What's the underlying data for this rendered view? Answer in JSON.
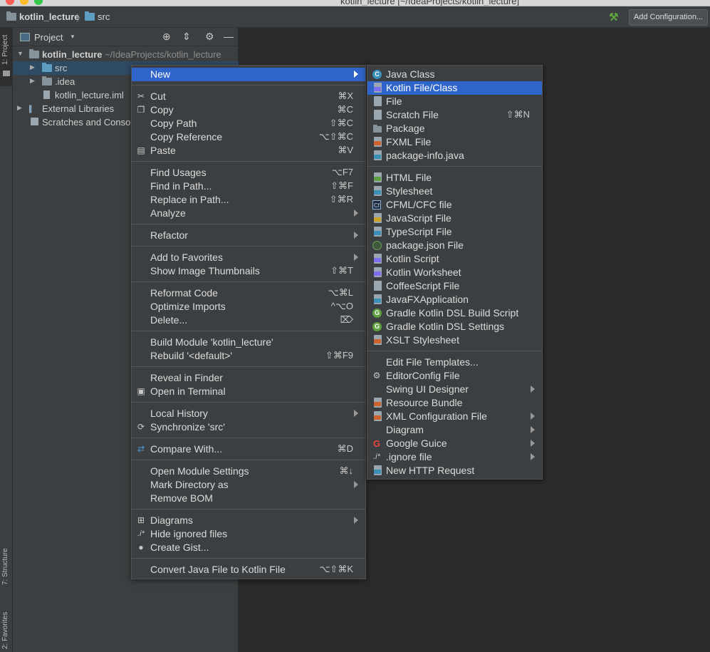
{
  "window": {
    "title": "kotlin_lecture [~/IdeaProjects/kotlin_lecture]"
  },
  "navbar": {
    "project": "kotlin_lecture",
    "folder": "src",
    "add_configuration": "Add Configuration..."
  },
  "stripe": {
    "project_tab": "1: Project",
    "structure_tab": "7: Structure",
    "favorites_tab": "2: Favorites"
  },
  "project_panel": {
    "title": "Project",
    "tree": {
      "root": "kotlin_lecture",
      "root_path": "~/IdeaProjects/kotlin_lecture",
      "src": "src",
      "idea": ".idea",
      "iml": "kotlin_lecture.iml",
      "ext_libs": "External Libraries",
      "scratches": "Scratches and Conso"
    }
  },
  "context_menu": {
    "new": "New",
    "cut": "Cut",
    "cut_sc": "⌘X",
    "copy": "Copy",
    "copy_sc": "⌘C",
    "copy_path": "Copy Path",
    "copy_path_sc": "⇧⌘C",
    "copy_ref": "Copy Reference",
    "copy_ref_sc": "⌥⇧⌘C",
    "paste": "Paste",
    "paste_sc": "⌘V",
    "find_usages": "Find Usages",
    "find_usages_sc": "⌥F7",
    "find_in_path": "Find in Path...",
    "find_in_path_sc": "⇧⌘F",
    "replace_in_path": "Replace in Path...",
    "replace_in_path_sc": "⇧⌘R",
    "analyze": "Analyze",
    "refactor": "Refactor",
    "add_favorites": "Add to Favorites",
    "show_thumbs": "Show Image Thumbnails",
    "show_thumbs_sc": "⇧⌘T",
    "reformat": "Reformat Code",
    "reformat_sc": "⌥⌘L",
    "optimize": "Optimize Imports",
    "optimize_sc": "^⌥O",
    "delete": "Delete...",
    "delete_sc": "⌦",
    "build_module": "Build Module 'kotlin_lecture'",
    "rebuild": "Rebuild '<default>'",
    "rebuild_sc": "⇧⌘F9",
    "reveal": "Reveal in Finder",
    "open_terminal": "Open in Terminal",
    "local_history": "Local History",
    "sync": "Synchronize 'src'",
    "compare": "Compare With...",
    "compare_sc": "⌘D",
    "module_settings": "Open Module Settings",
    "module_settings_sc": "⌘↓",
    "mark_dir": "Mark Directory as",
    "remove_bom": "Remove BOM",
    "diagrams": "Diagrams",
    "hide_ignored": "Hide ignored files",
    "create_gist": "Create Gist...",
    "convert": "Convert Java File to Kotlin File",
    "convert_sc": "⌥⇧⌘K"
  },
  "new_submenu": {
    "java_class": "Java Class",
    "kotlin_file": "Kotlin File/Class",
    "file": "File",
    "scratch": "Scratch File",
    "scratch_sc": "⇧⌘N",
    "package": "Package",
    "fxml": "FXML File",
    "package_info": "package-info.java",
    "html": "HTML File",
    "stylesheet": "Stylesheet",
    "cfml": "CFML/CFC file",
    "javascript": "JavaScript File",
    "typescript": "TypeScript File",
    "package_json": "package.json File",
    "kotlin_script": "Kotlin Script",
    "kotlin_worksheet": "Kotlin Worksheet",
    "coffeescript": "CoffeeScript File",
    "javafx": "JavaFXApplication",
    "gradle_build": "Gradle Kotlin DSL Build Script",
    "gradle_settings": "Gradle Kotlin DSL Settings",
    "xslt": "XSLT Stylesheet",
    "edit_templates": "Edit File Templates...",
    "editorconfig": "EditorConfig File",
    "swing": "Swing UI Designer",
    "resource_bundle": "Resource Bundle",
    "xml_config": "XML Configuration File",
    "diagram": "Diagram",
    "guice": "Google Guice",
    "ignore": ".ignore file",
    "http": "New HTTP Request"
  },
  "colors": {
    "highlight": "#2f65ca",
    "menu_bg": "#3c3f41",
    "editor_bg": "#2b2b2b",
    "kotlin": "#7f6df2",
    "java_class": "#3a8fb7",
    "gradle": "#5f9e41"
  }
}
